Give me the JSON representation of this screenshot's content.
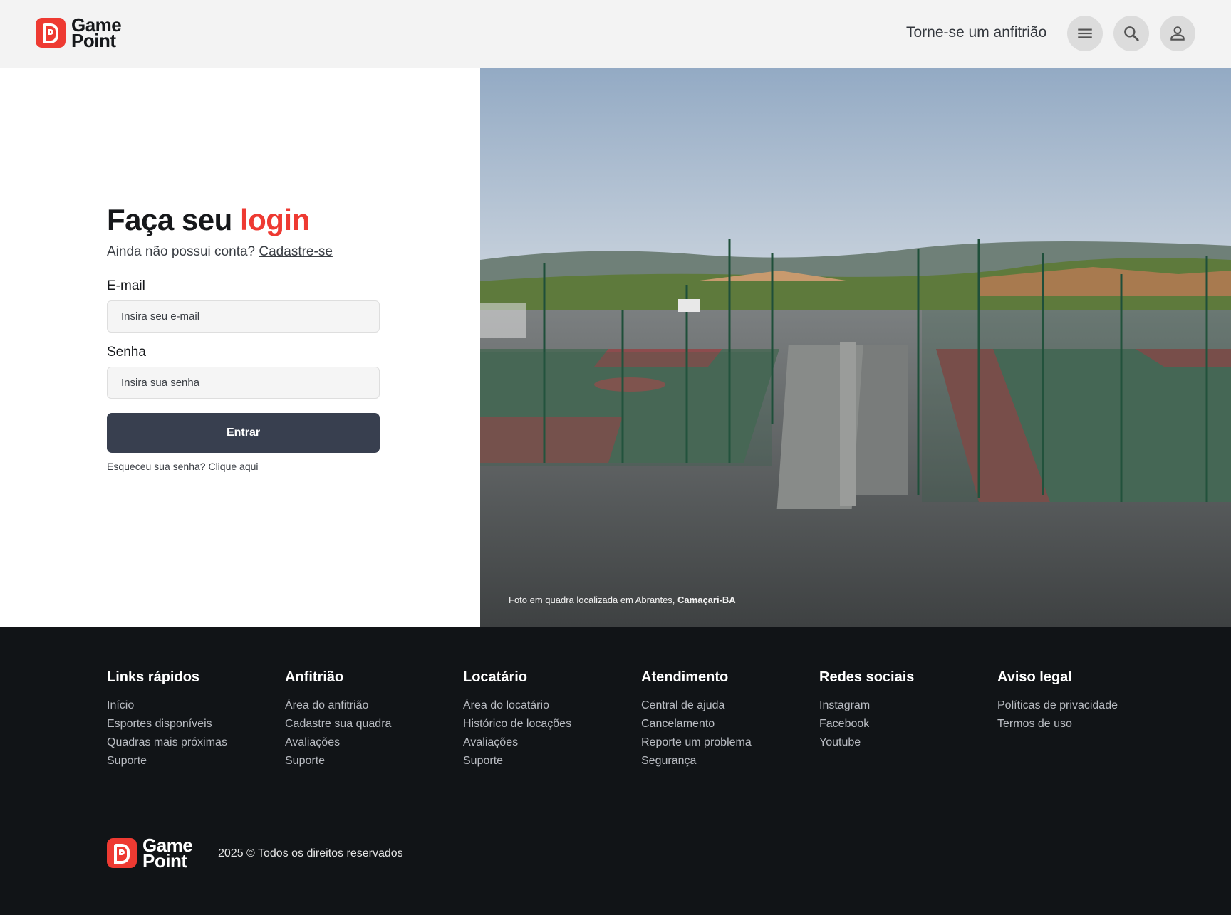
{
  "brand": {
    "line1": "Game",
    "line2": "Point",
    "accent_color": "#ee3a32"
  },
  "header": {
    "host_link": "Torne-se um anfitrião",
    "icons": [
      "menu-icon",
      "search-icon",
      "user-icon"
    ]
  },
  "login": {
    "title_part1": "Faça seu",
    "title_part2": "login",
    "subtitle_text": "Ainda não possui conta?",
    "signup_link": "Cadastre-se",
    "email_label": "E-mail",
    "email_placeholder": "Insira seu e-mail",
    "password_label": "Senha",
    "password_placeholder": "Insira sua senha",
    "submit_label": "Entrar",
    "forgot_text": "Esqueceu sua senha?",
    "forgot_link": "Clique aqui",
    "button_color": "#383f4f"
  },
  "photo": {
    "caption_text": "Foto em quadra localizada em Abrantes,",
    "caption_place": "Camaçari-BA"
  },
  "footer": {
    "columns": [
      {
        "title": "Links rápidos",
        "links": [
          "Início",
          "Esportes disponíveis",
          "Quadras mais próximas",
          "Suporte"
        ]
      },
      {
        "title": "Anfitrião",
        "links": [
          "Área do anfitrião",
          "Cadastre sua quadra",
          "Avaliações",
          "Suporte"
        ]
      },
      {
        "title": "Locatário",
        "links": [
          "Área do locatário",
          "Histórico de locações",
          "Avaliações",
          "Suporte"
        ]
      },
      {
        "title": "Atendimento",
        "links": [
          "Central de ajuda",
          "Cancelamento",
          "Reporte um problema",
          "Segurança"
        ]
      },
      {
        "title": "Redes sociais",
        "links": [
          "Instagram",
          "Facebook",
          "Youtube"
        ]
      },
      {
        "title": "Aviso legal",
        "links": [
          "Políticas de privacidade",
          "Termos de uso"
        ]
      }
    ],
    "copyright": "2025 © Todos os direitos reservados"
  }
}
